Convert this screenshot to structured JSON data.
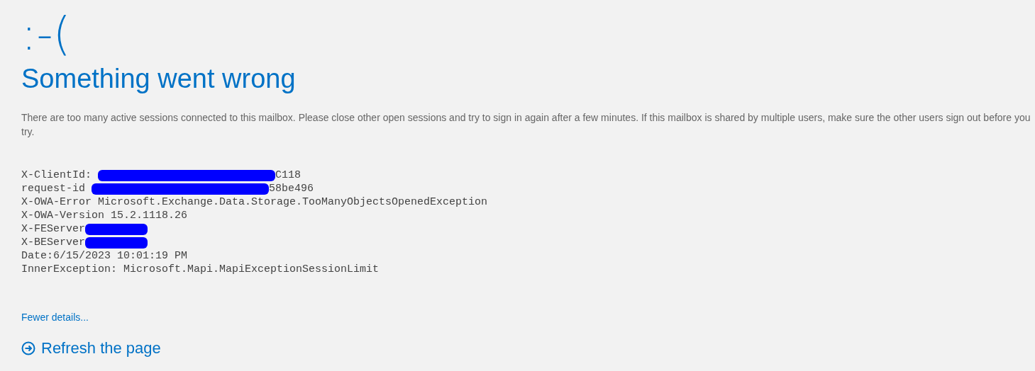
{
  "face": ":-(",
  "title": "Something went wrong",
  "message": "There are too many active sessions connected to this mailbox. Please close other open sessions and try to sign in again after a few minutes. If this mailbox is shared by multiple users, make sure the other users sign out before you try.",
  "details": [
    {
      "parts": [
        {
          "kind": "text",
          "text": "X-ClientId: "
        },
        {
          "kind": "redaction"
        },
        {
          "kind": "text",
          "text": "C118"
        }
      ]
    },
    {
      "parts": [
        {
          "kind": "text",
          "text": "request-id "
        },
        {
          "kind": "redaction"
        },
        {
          "kind": "text",
          "text": "58be496"
        }
      ]
    },
    {
      "parts": [
        {
          "kind": "text",
          "text": "X-OWA-Error Microsoft.Exchange.Data.Storage.TooManyObjectsOpenedException"
        }
      ]
    },
    {
      "parts": [
        {
          "kind": "text",
          "text": "X-OWA-Version 15.2.1118.26"
        }
      ]
    },
    {
      "parts": [
        {
          "kind": "text",
          "text": "X-FEServer"
        },
        {
          "kind": "redaction"
        }
      ]
    },
    {
      "parts": [
        {
          "kind": "text",
          "text": "X-BEServer"
        },
        {
          "kind": "redaction"
        }
      ]
    },
    {
      "parts": [
        {
          "kind": "text",
          "text": "Date:6/15/2023 10:01:19 PM"
        }
      ]
    },
    {
      "parts": [
        {
          "kind": "text",
          "text": "InnerException: Microsoft.Mapi.MapiExceptionSessionLimit"
        }
      ]
    }
  ],
  "details_link": "Fewer details...",
  "refresh": "Refresh the page"
}
